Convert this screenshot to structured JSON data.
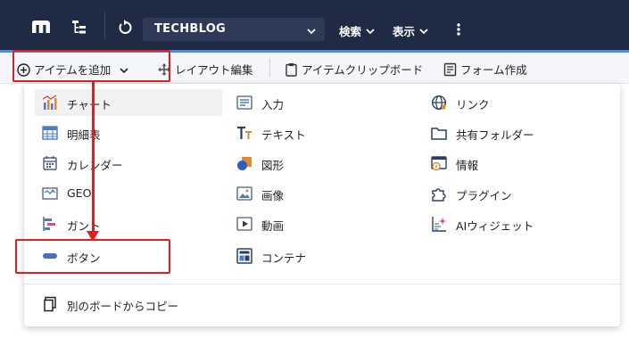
{
  "header": {
    "app_select": "TECHBLOG",
    "menu_search": "検索",
    "menu_view": "表示"
  },
  "toolbar": {
    "add_item": "アイテムを追加",
    "layout_edit": "レイアウト編集",
    "clipboard": "アイテムクリップボード",
    "form_create": "フォーム作成"
  },
  "add_menu": {
    "col1": [
      {
        "label": "チャート",
        "icon": "chart-icon"
      },
      {
        "label": "明細表",
        "icon": "table-icon"
      },
      {
        "label": "カレンダー",
        "icon": "calendar-icon"
      },
      {
        "label": "GEO",
        "icon": "map-icon"
      },
      {
        "label": "ガント",
        "icon": "gantt-icon"
      },
      {
        "label": "ボタン",
        "icon": "button-icon"
      }
    ],
    "col2": [
      {
        "label": "入力",
        "icon": "input-icon"
      },
      {
        "label": "テキスト",
        "icon": "text-icon"
      },
      {
        "label": "図形",
        "icon": "shape-icon"
      },
      {
        "label": "画像",
        "icon": "image-icon"
      },
      {
        "label": "動画",
        "icon": "video-icon"
      },
      {
        "label": "コンテナ",
        "icon": "container-icon"
      }
    ],
    "col3": [
      {
        "label": "リンク",
        "icon": "link-icon"
      },
      {
        "label": "共有フォルダー",
        "icon": "folder-icon"
      },
      {
        "label": "情報",
        "icon": "info-icon"
      },
      {
        "label": "プラグイン",
        "icon": "plugin-icon"
      },
      {
        "label": "AIウィジェット",
        "icon": "ai-widget-icon"
      }
    ],
    "copy_from_board": "別のボードからコピー"
  },
  "colors": {
    "topbar": "#1f2b44",
    "highlight": "#e02020",
    "accent": "#4f8fd8"
  }
}
